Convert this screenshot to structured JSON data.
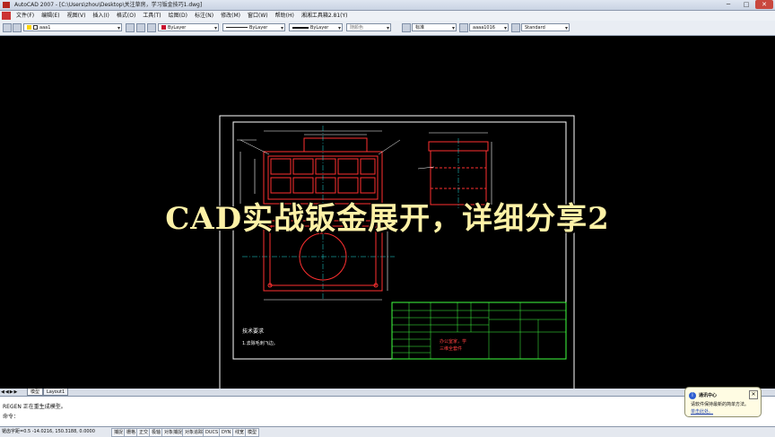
{
  "window": {
    "title": "AutoCAD 2007 - [C:\\Users\\zhou\\Desktop\\关注草房，学习钣金技巧1.dwg]",
    "minimize": "─",
    "maximize": "□",
    "close": "✕"
  },
  "menubar": {
    "items": [
      "文件(F)",
      "编辑(E)",
      "视图(V)",
      "插入(I)",
      "格式(O)",
      "工具(T)",
      "绘图(D)",
      "标注(N)",
      "修改(M)",
      "窗口(W)",
      "帮助(H)",
      "湘湘工具箱2.81(Y)"
    ]
  },
  "toolbar": {
    "layer_value": "aaa1",
    "color_value": "ByLayer",
    "linetype_value": "ByLayer",
    "lineweight_value": "ByLayer",
    "plotstyle_value": "随颜色",
    "textstyle_value": "标准",
    "dimstyle_value": "aaaa1016",
    "tablestyle_value": "Standard"
  },
  "overlay": {
    "title": "CAD实战钣金展开，详细分享2"
  },
  "tabs": {
    "nav": "◀◀▶▶",
    "model": "模型",
    "layout": "Layout1"
  },
  "command": {
    "line1": "REGEN 正在重生成模型。",
    "line2": "命令："
  },
  "status": {
    "coords": "锯齿字距=0.5  -14.0216, 150.3188, 0.0000",
    "buttons": [
      "捕捉",
      "栅格",
      "正交",
      "极轴",
      "对象捕捉",
      "对象追踪",
      "DUCS",
      "DYN",
      "线宽",
      "模型"
    ]
  },
  "notification": {
    "title": "通讯中心",
    "body": "请软件保持最新的简单方法。",
    "link": "单击此处。",
    "info_icon": "i",
    "close": "✕"
  },
  "drawing": {
    "sheet_note_title": "技术要求",
    "sheet_note_item": "1.去除毛刺飞边。",
    "red_note_1": "办公室家，学",
    "red_note_2": "三维全套件"
  },
  "colors": {
    "frame": "#ffffff",
    "outline": "#ff3030",
    "dims": "#ffffff",
    "center": "#20e0e0",
    "titleblock": "#40ff40",
    "overlay_text": "#fdf1a6"
  }
}
